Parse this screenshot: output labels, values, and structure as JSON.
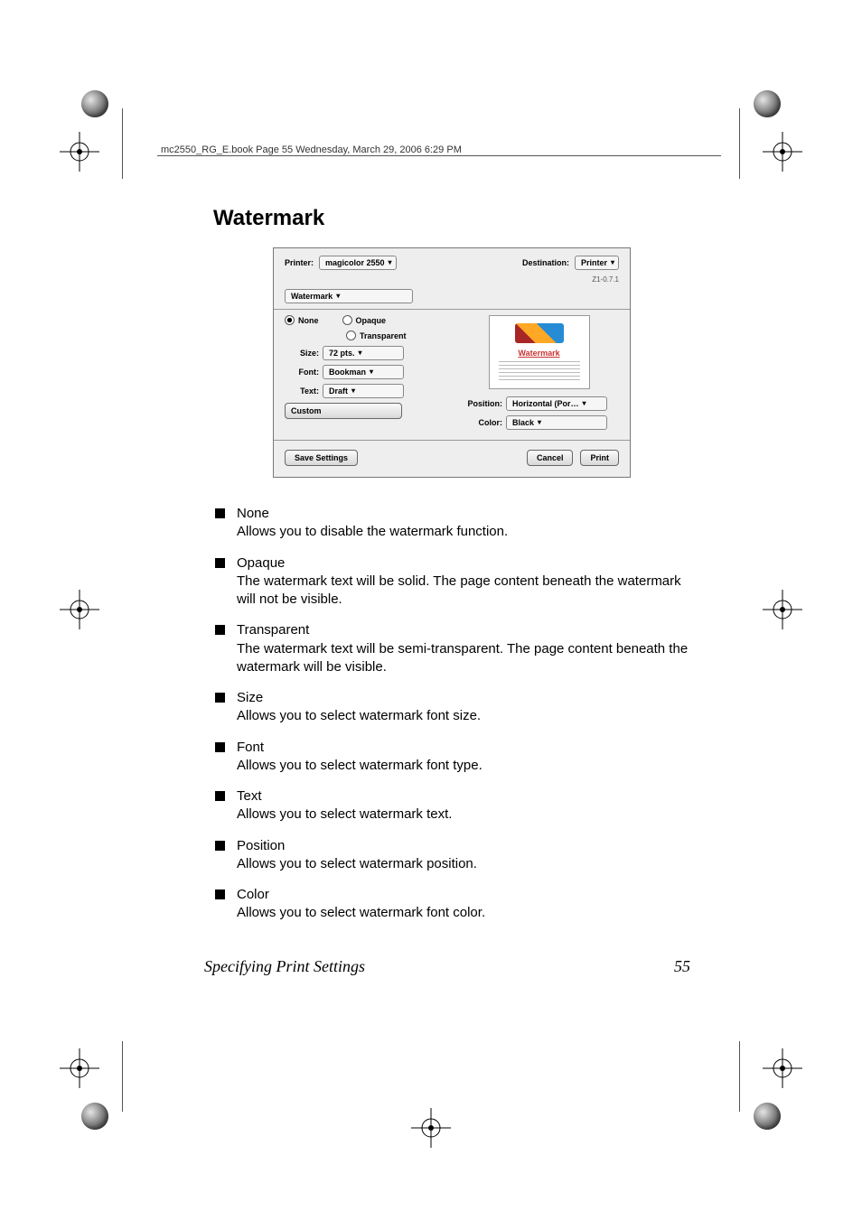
{
  "header": {
    "running_head": "mc2550_RG_E.book  Page 55  Wednesday, March 29, 2006  6:29 PM"
  },
  "heading": "Watermark",
  "dialog": {
    "version": "Z1-0.7.1",
    "printer_label": "Printer:",
    "printer_value": "magicolor 2550",
    "dest_label": "Destination:",
    "dest_value": "Printer",
    "section_value": "Watermark",
    "radio_none": "None",
    "radio_opaque": "Opaque",
    "radio_transparent": "Transparent",
    "size_label": "Size:",
    "size_value": "72 pts.",
    "font_label": "Font:",
    "font_value": "Bookman",
    "text_label": "Text:",
    "text_value": "Draft",
    "custom_btn": "Custom",
    "preview_wm": "Watermark",
    "position_label": "Position:",
    "position_value": "Horizontal (Por…",
    "color_label": "Color:",
    "color_value": "Black",
    "save_btn": "Save Settings",
    "cancel_btn": "Cancel",
    "print_btn": "Print"
  },
  "items": [
    {
      "term": "None",
      "desc": "Allows you to disable the watermark function."
    },
    {
      "term": "Opaque",
      "desc": "The watermark text will be solid. The page content beneath the watermark will not be visible."
    },
    {
      "term": "Transparent",
      "desc": "The watermark text will be semi-transparent. The page content beneath the watermark will be visible."
    },
    {
      "term": "Size",
      "desc": "Allows you to select watermark font size."
    },
    {
      "term": "Font",
      "desc": "Allows you to select watermark font type."
    },
    {
      "term": "Text",
      "desc": "Allows you to select watermark text."
    },
    {
      "term": "Position",
      "desc": "Allows you to select watermark position."
    },
    {
      "term": "Color",
      "desc": "Allows you to select watermark font color."
    }
  ],
  "footer": {
    "title": "Specifying Print Settings",
    "page": "55"
  }
}
